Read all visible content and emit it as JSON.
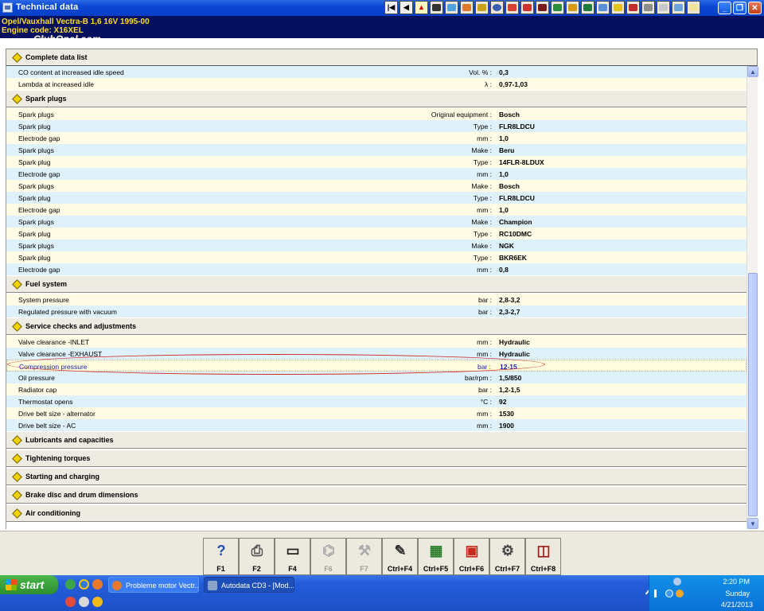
{
  "window": {
    "title": "Technical data"
  },
  "vehicle": {
    "line1": "Opel/Vauxhall   Vectra-B  1,6 16V 1995-00",
    "line2": "Engine code: X16XEL",
    "watermark": "ClubOpel.com"
  },
  "complete_data_list": "Complete data list",
  "top_rows": [
    {
      "label": "CO content at increased idle speed",
      "unit": "Vol. % :",
      "value": "0,3"
    },
    {
      "label": "Lambda at increased idle",
      "unit": "λ :",
      "value": "0,97-1,03"
    }
  ],
  "spark_plugs": {
    "title": "Spark plugs",
    "rows": [
      {
        "label": "Spark plugs",
        "unit": "Original equipment :",
        "value": "Bosch"
      },
      {
        "label": "Spark plug",
        "unit": "Type :",
        "value": "FLR8LDCU"
      },
      {
        "label": "Electrode gap",
        "unit": "mm :",
        "value": "1,0"
      },
      {
        "label": "Spark plugs",
        "unit": "Make :",
        "value": "Beru"
      },
      {
        "label": "Spark plug",
        "unit": "Type :",
        "value": "14FLR-8LDUX"
      },
      {
        "label": "Electrode gap",
        "unit": "mm :",
        "value": "1,0"
      },
      {
        "label": "Spark plugs",
        "unit": "Make :",
        "value": "Bosch"
      },
      {
        "label": "Spark plug",
        "unit": "Type :",
        "value": "FLR8LDCU"
      },
      {
        "label": "Electrode gap",
        "unit": "mm :",
        "value": "1,0"
      },
      {
        "label": "Spark plugs",
        "unit": "Make :",
        "value": "Champion"
      },
      {
        "label": "Spark plug",
        "unit": "Type :",
        "value": "RC10DMC"
      },
      {
        "label": "Spark plugs",
        "unit": "Make :",
        "value": "NGK"
      },
      {
        "label": "Spark plug",
        "unit": "Type :",
        "value": "BKR6EK"
      },
      {
        "label": "Electrode gap",
        "unit": "mm :",
        "value": "0,8"
      }
    ]
  },
  "fuel_system": {
    "title": "Fuel system",
    "rows": [
      {
        "label": "System pressure",
        "unit": "bar :",
        "value": "2,8-3,2"
      },
      {
        "label": "Regulated pressure with vacuum",
        "unit": "bar :",
        "value": "2,3-2,7"
      }
    ]
  },
  "service_checks": {
    "title": "Service checks and adjustments",
    "rows": [
      {
        "label": "Valve clearance  -INLET",
        "unit": "mm :",
        "value": "Hydraulic"
      },
      {
        "label": "Valve clearance  -EXHAUST",
        "unit": "mm :",
        "value": "Hydraulic"
      },
      {
        "label": "Compression pressure",
        "unit": "bar :",
        "value": "12-15"
      },
      {
        "label": "Oil pressure",
        "unit": "bar/rpm :",
        "value": "1,5/850"
      },
      {
        "label": "Radiator cap",
        "unit": "bar :",
        "value": "1,2-1,5"
      },
      {
        "label": "Thermostat opens",
        "unit": "°C :",
        "value": "92"
      },
      {
        "label": "Drive belt size - alternator",
        "unit": "mm :",
        "value": "1530"
      },
      {
        "label": "Drive belt size - AC",
        "unit": "mm :",
        "value": "1900"
      }
    ]
  },
  "collapsed_sections": [
    "Lubricants and capacities",
    "Tightening torques",
    "Starting and charging",
    "Brake disc and drum dimensions",
    "Air conditioning"
  ],
  "fkeys": [
    {
      "label": "F1",
      "icon": "help-icon",
      "enabled": true
    },
    {
      "label": "F2",
      "icon": "print-icon",
      "enabled": true
    },
    {
      "label": "F4",
      "icon": "screen-icon",
      "enabled": true
    },
    {
      "label": "F6",
      "icon": "diagram-icon",
      "enabled": false
    },
    {
      "label": "F7",
      "icon": "tool-icon",
      "enabled": false
    },
    {
      "label": "Ctrl+F4",
      "icon": "notes-icon",
      "enabled": true
    },
    {
      "label": "Ctrl+F5",
      "icon": "table-icon",
      "enabled": true
    },
    {
      "label": "Ctrl+F6",
      "icon": "calendar-icon",
      "enabled": true
    },
    {
      "label": "Ctrl+F7",
      "icon": "gears-icon",
      "enabled": true
    },
    {
      "label": "Ctrl+F8",
      "icon": "lift-icon",
      "enabled": true
    }
  ],
  "taskbar": {
    "start": "start",
    "tasks": [
      {
        "label": "Probleme motor Vectr..."
      },
      {
        "label": "Autodata CD3 - [Mod..."
      }
    ],
    "clock": {
      "time": "2:20 PM",
      "day": "Sunday",
      "date": "4/21/2013"
    }
  },
  "colors": {
    "row_light": "#dff1fb",
    "row_cream": "#fffbe5",
    "header_bg": "#05115e",
    "header_text": "#ffdd20",
    "highlight_oval": "#d0261c"
  }
}
